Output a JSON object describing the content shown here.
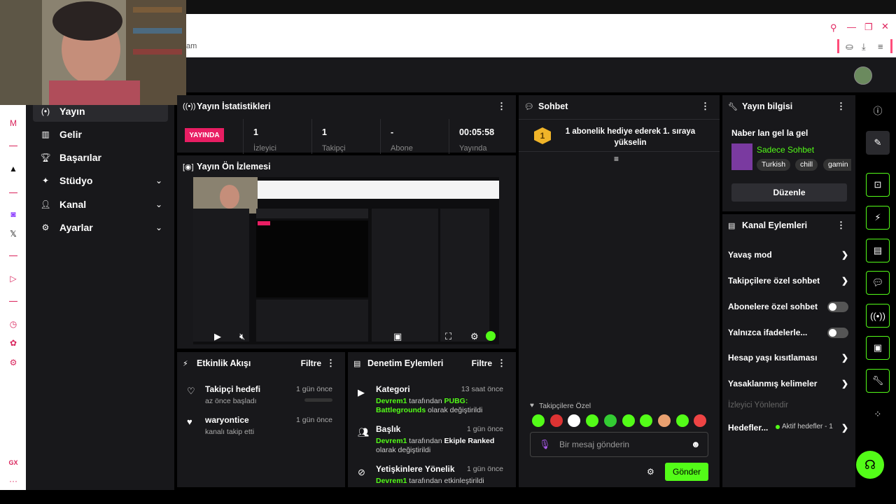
{
  "browser": {
    "url_fragment": "am"
  },
  "sidebar": {
    "items": [
      {
        "label": "Yayın",
        "icon": "broadcast-icon",
        "active": true
      },
      {
        "label": "Gelir",
        "icon": "chart-icon"
      },
      {
        "label": "Başarılar",
        "icon": "trophy-icon"
      },
      {
        "label": "Stüdyo",
        "icon": "studio-icon",
        "expandable": true
      },
      {
        "label": "Kanal",
        "icon": "channel-icon",
        "expandable": true
      },
      {
        "label": "Ayarlar",
        "icon": "gear-icon",
        "expandable": true
      }
    ]
  },
  "stats": {
    "title": "Yayın İstatistikleri",
    "live_badge": "YAYINDA",
    "cells": [
      {
        "value": "1",
        "label": "İzleyici"
      },
      {
        "value": "1",
        "label": "Takipçi"
      },
      {
        "value": "-",
        "label": "Abone"
      },
      {
        "value": "00:05:58",
        "label": "Yayında"
      }
    ]
  },
  "preview": {
    "title": "Yayın Ön İzlemesi"
  },
  "activity": {
    "title": "Etkinlik Akışı",
    "filter": "Filtre",
    "items": [
      {
        "title": "Takipçi hedefi",
        "sub": "az önce başladı",
        "time": "1 gün önce"
      },
      {
        "title": "waryontice",
        "sub": "kanalı takip etti",
        "time": "1 gün önce"
      }
    ]
  },
  "moderation": {
    "title": "Denetim Eylemleri",
    "filter": "Filtre",
    "items": [
      {
        "title": "Kategori",
        "time": "13 saat önce",
        "user": "Devrem1",
        "mid": "tarafından",
        "value": "PUBG: Battlegrounds",
        "end": "olarak değiştirildi"
      },
      {
        "title": "Başlık",
        "time": "1 gün önce",
        "user": "Devrem1",
        "mid": "tarafından",
        "value": "Ekiple Ranked",
        "end": "olarak değiştirildi"
      },
      {
        "title": "Yetişkinlere Yönelik",
        "time": "1 gün önce",
        "user": "Devrem1",
        "mid": "tarafından etkinleştirildi",
        "value": "",
        "end": ""
      }
    ]
  },
  "chat": {
    "title": "Sohbet",
    "banner": "1 abonelik hediye ederek 1. sıraya yükselin",
    "rank": "1",
    "mode_label": "Takipçilere Özel",
    "input_placeholder": "Bir mesaj gönderin",
    "send": "Gönder"
  },
  "stream_info": {
    "title": "Yayın bilgisi",
    "stream_title": "Naber lan gel la gel",
    "category": "Sadece Sohbet",
    "tags": [
      "Turkish",
      "chill",
      "gamin"
    ],
    "edit": "Düzenle"
  },
  "channel_actions": {
    "title": "Kanal Eylemleri",
    "items": [
      {
        "label": "Yavaş mod",
        "kind": "chevron"
      },
      {
        "label": "Takipçilere özel sohbet",
        "kind": "chevron"
      },
      {
        "label": "Abonelere özel sohbet",
        "kind": "toggle"
      },
      {
        "label": "Yalnızca ifadelerle...",
        "kind": "toggle"
      },
      {
        "label": "Hesap yaşı kısıtlaması",
        "kind": "chevron"
      },
      {
        "label": "Yasaklanmış kelimeler",
        "kind": "chevron"
      }
    ],
    "redirect": "İzleyici Yönlendir",
    "goals": "Hedefler...",
    "goals_status": "Aktif hedefler - 1"
  },
  "colors": {
    "accent": "#53fc18",
    "live": "#e91e63",
    "panel": "#18181b"
  }
}
